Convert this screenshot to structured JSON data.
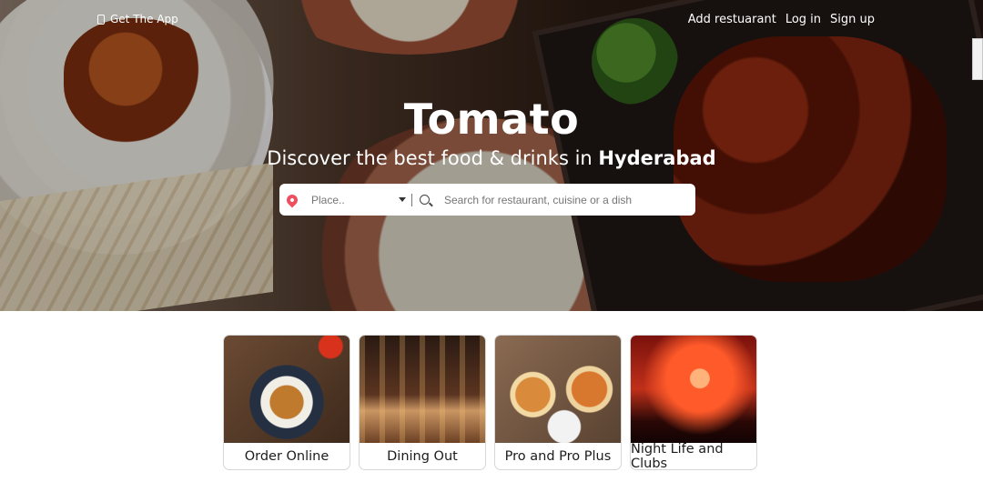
{
  "nav": {
    "get_app": "Get The App",
    "add_restaurant": "Add restuarant",
    "login": "Log in",
    "signup": "Sign up"
  },
  "hero": {
    "brand": "Tomato",
    "tagline_prefix": "Discover the best food & drinks in ",
    "city": "Hyderabad"
  },
  "search": {
    "place_placeholder": "Place..",
    "query_placeholder": "Search for restaurant, cuisine or a dish"
  },
  "icons": {
    "phone": "phone-icon",
    "location": "location-pin-icon",
    "dropdown": "caret-down-icon",
    "search": "search-icon"
  },
  "colors": {
    "location_pin": "#ef4f5f"
  },
  "cards": [
    {
      "label": "Order Online"
    },
    {
      "label": "Dining Out"
    },
    {
      "label": "Pro and Pro Plus"
    },
    {
      "label": "Night Life and Clubs"
    }
  ]
}
